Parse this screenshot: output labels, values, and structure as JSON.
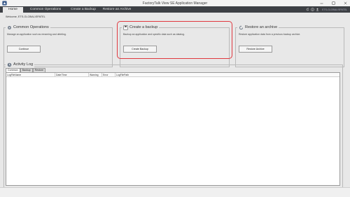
{
  "window": {
    "title": "FactoryTalk View SE Application Manager",
    "controls": [
      "minimize-icon",
      "maximize-icon",
      "close-icon"
    ]
  },
  "menu": {
    "items": [
      {
        "label": "Home",
        "active": true
      },
      {
        "label": "Common Operations",
        "active": false
      },
      {
        "label": "Create a Backup",
        "active": false
      },
      {
        "label": "Restore an Archive",
        "active": false
      }
    ],
    "tray_text": "ETS-GLOBAL\\SPATEL",
    "tray_icons": [
      "refresh-icon",
      "info-icon",
      "user-icon"
    ]
  },
  "welcome": "Welcome, ETS-GLOBAL\\SPATEL",
  "groups": [
    {
      "title": "Common Operations",
      "icon": "gear-icon",
      "description": "Manage an application such as renaming and deleting.",
      "button": "Continue"
    },
    {
      "title": "Create a backup",
      "icon": "backup-icon",
      "description": "Backup an application and specific data such as datalog.",
      "button": "Create Backup"
    },
    {
      "title": "Restore an archive",
      "icon": "restore-icon",
      "description": "Restore application data from a previous backup archive.",
      "button": "Restore Archive"
    }
  ],
  "activity": {
    "title": "Activity Log",
    "icon": "clock-icon",
    "tabs": [
      {
        "label": "Common",
        "active": true
      },
      {
        "label": "Backup",
        "active": false
      },
      {
        "label": "Restore",
        "active": false
      }
    ],
    "columns": [
      "LogFileName",
      "Date/Time",
      "Warning",
      "Error",
      "LogFilePath"
    ]
  },
  "colors": {
    "menubar": "#3d4045",
    "highlight": "#e0383f",
    "panel": "#e8e8e8"
  }
}
